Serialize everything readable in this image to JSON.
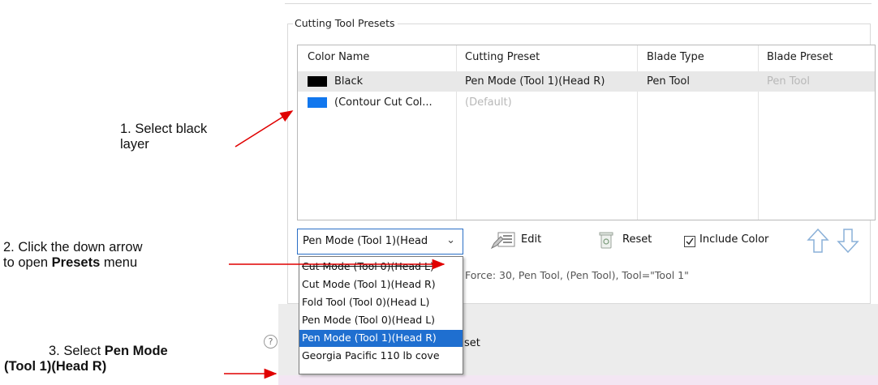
{
  "group": {
    "title": "Cutting Tool Presets"
  },
  "table": {
    "columns": [
      "Color Name",
      "Cutting Preset",
      "Blade Type",
      "Blade Preset"
    ],
    "rows": [
      {
        "color": "#000000",
        "name": "Black",
        "preset": "Pen Mode (Tool 1)(Head R)",
        "blade_type": "Pen Tool",
        "blade_preset": "Pen Tool",
        "selected": true
      },
      {
        "color": "#1177ee",
        "name": "(Contour Cut Col...",
        "preset": "(Default)",
        "blade_type": "",
        "blade_preset": "",
        "selected": false
      }
    ]
  },
  "toolbar": {
    "preset_value": "Pen Mode (Tool 1)(Head",
    "edit_label": "Edit",
    "reset_label": "Reset",
    "include_color_label": "Include Color",
    "include_color_checked": true
  },
  "info": {
    "text": "Force: 30, Pen Tool, (Pen Tool), Tool=\"Tool 1\""
  },
  "dropdown": {
    "options": [
      "Cut Mode (Tool 0)(Head L)",
      "Cut Mode (Tool 1)(Head R)",
      "Fold Tool (Tool 0)(Head L)",
      "Pen Mode (Tool 0)(Head L)",
      "Pen Mode (Tool 1)(Head R)",
      "Georgia Pacific 110 lb cove"
    ],
    "highlighted_index": 4
  },
  "footer": {
    "reset_text": "set"
  },
  "annotations": {
    "step1_line1": "1. Select black",
    "step1_line2": "layer",
    "step2_line1": "2. Click the down arrow",
    "step2_prefix": "to open ",
    "step2_bold": "Presets",
    "step2_suffix": " menu",
    "step3_prefix": "3. Select ",
    "step3_bold1": "Pen Mode",
    "step3_bold2": "(Tool 1)(Head R)"
  },
  "colors": {
    "accent": "#1f6fd0",
    "arrow": "#e00000"
  }
}
